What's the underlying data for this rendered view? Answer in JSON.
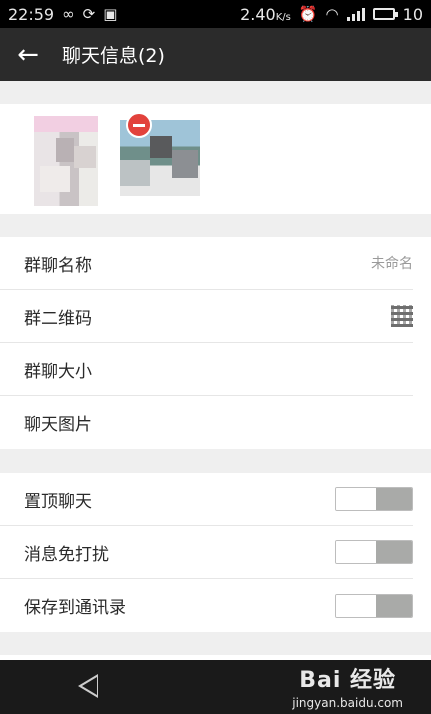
{
  "status_bar": {
    "time": "22:59",
    "data_speed": "2.40",
    "data_unit": "K/s",
    "battery_level": "10"
  },
  "header": {
    "title": "聊天信息(2)"
  },
  "settings_group": {
    "items": [
      {
        "label": "群聊名称",
        "value": "未命名"
      },
      {
        "label": "群二维码"
      },
      {
        "label": "群聊大小"
      },
      {
        "label": "聊天图片"
      }
    ]
  },
  "toggle_group": {
    "items": [
      {
        "label": "置顶聊天",
        "on": false
      },
      {
        "label": "消息免打扰",
        "on": false
      },
      {
        "label": "保存到通讯录",
        "on": false
      }
    ]
  },
  "watermark": {
    "main": "Bai 经验",
    "sub": "jingyan.baidu.com"
  }
}
